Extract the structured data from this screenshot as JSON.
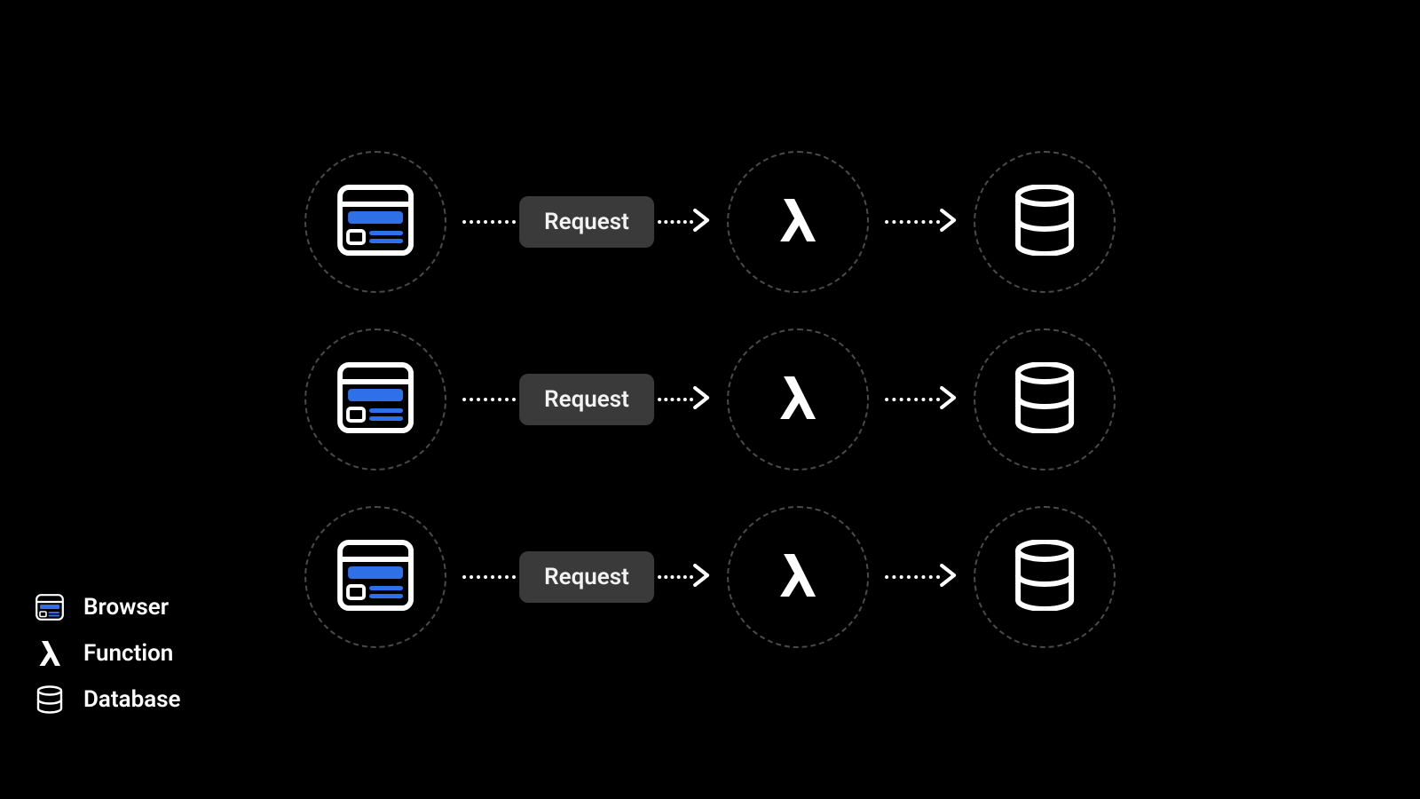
{
  "flow": {
    "rows": 3,
    "request_label": "Request"
  },
  "legend": {
    "items": [
      {
        "label": "Browser"
      },
      {
        "label": "Function"
      },
      {
        "label": "Database"
      }
    ]
  },
  "colors": {
    "background": "#000000",
    "foreground": "#ffffff",
    "blue": "#2f6fe8",
    "dashed": "#4a4a4a",
    "badge_bg": "#3a3a3a"
  }
}
